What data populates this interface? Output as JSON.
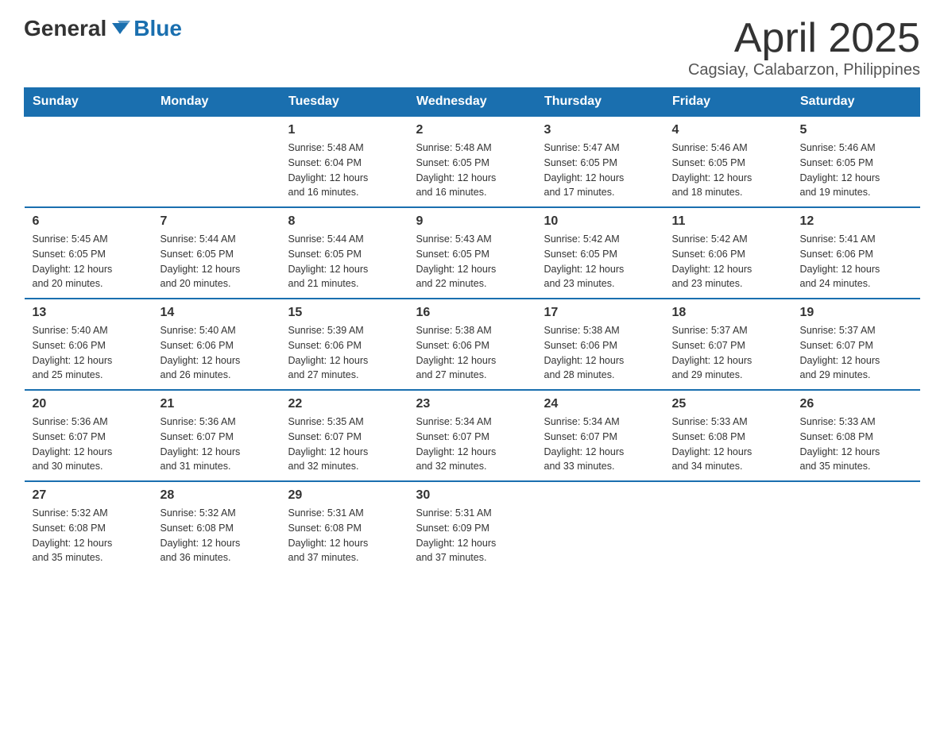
{
  "logo": {
    "text_general": "General",
    "text_blue": "Blue"
  },
  "header": {
    "title": "April 2025",
    "subtitle": "Cagsiay, Calabarzon, Philippines"
  },
  "weekdays": [
    "Sunday",
    "Monday",
    "Tuesday",
    "Wednesday",
    "Thursday",
    "Friday",
    "Saturday"
  ],
  "weeks": [
    [
      {
        "day": "",
        "info": ""
      },
      {
        "day": "",
        "info": ""
      },
      {
        "day": "1",
        "info": "Sunrise: 5:48 AM\nSunset: 6:04 PM\nDaylight: 12 hours\nand 16 minutes."
      },
      {
        "day": "2",
        "info": "Sunrise: 5:48 AM\nSunset: 6:05 PM\nDaylight: 12 hours\nand 16 minutes."
      },
      {
        "day": "3",
        "info": "Sunrise: 5:47 AM\nSunset: 6:05 PM\nDaylight: 12 hours\nand 17 minutes."
      },
      {
        "day": "4",
        "info": "Sunrise: 5:46 AM\nSunset: 6:05 PM\nDaylight: 12 hours\nand 18 minutes."
      },
      {
        "day": "5",
        "info": "Sunrise: 5:46 AM\nSunset: 6:05 PM\nDaylight: 12 hours\nand 19 minutes."
      }
    ],
    [
      {
        "day": "6",
        "info": "Sunrise: 5:45 AM\nSunset: 6:05 PM\nDaylight: 12 hours\nand 20 minutes."
      },
      {
        "day": "7",
        "info": "Sunrise: 5:44 AM\nSunset: 6:05 PM\nDaylight: 12 hours\nand 20 minutes."
      },
      {
        "day": "8",
        "info": "Sunrise: 5:44 AM\nSunset: 6:05 PM\nDaylight: 12 hours\nand 21 minutes."
      },
      {
        "day": "9",
        "info": "Sunrise: 5:43 AM\nSunset: 6:05 PM\nDaylight: 12 hours\nand 22 minutes."
      },
      {
        "day": "10",
        "info": "Sunrise: 5:42 AM\nSunset: 6:05 PM\nDaylight: 12 hours\nand 23 minutes."
      },
      {
        "day": "11",
        "info": "Sunrise: 5:42 AM\nSunset: 6:06 PM\nDaylight: 12 hours\nand 23 minutes."
      },
      {
        "day": "12",
        "info": "Sunrise: 5:41 AM\nSunset: 6:06 PM\nDaylight: 12 hours\nand 24 minutes."
      }
    ],
    [
      {
        "day": "13",
        "info": "Sunrise: 5:40 AM\nSunset: 6:06 PM\nDaylight: 12 hours\nand 25 minutes."
      },
      {
        "day": "14",
        "info": "Sunrise: 5:40 AM\nSunset: 6:06 PM\nDaylight: 12 hours\nand 26 minutes."
      },
      {
        "day": "15",
        "info": "Sunrise: 5:39 AM\nSunset: 6:06 PM\nDaylight: 12 hours\nand 27 minutes."
      },
      {
        "day": "16",
        "info": "Sunrise: 5:38 AM\nSunset: 6:06 PM\nDaylight: 12 hours\nand 27 minutes."
      },
      {
        "day": "17",
        "info": "Sunrise: 5:38 AM\nSunset: 6:06 PM\nDaylight: 12 hours\nand 28 minutes."
      },
      {
        "day": "18",
        "info": "Sunrise: 5:37 AM\nSunset: 6:07 PM\nDaylight: 12 hours\nand 29 minutes."
      },
      {
        "day": "19",
        "info": "Sunrise: 5:37 AM\nSunset: 6:07 PM\nDaylight: 12 hours\nand 29 minutes."
      }
    ],
    [
      {
        "day": "20",
        "info": "Sunrise: 5:36 AM\nSunset: 6:07 PM\nDaylight: 12 hours\nand 30 minutes."
      },
      {
        "day": "21",
        "info": "Sunrise: 5:36 AM\nSunset: 6:07 PM\nDaylight: 12 hours\nand 31 minutes."
      },
      {
        "day": "22",
        "info": "Sunrise: 5:35 AM\nSunset: 6:07 PM\nDaylight: 12 hours\nand 32 minutes."
      },
      {
        "day": "23",
        "info": "Sunrise: 5:34 AM\nSunset: 6:07 PM\nDaylight: 12 hours\nand 32 minutes."
      },
      {
        "day": "24",
        "info": "Sunrise: 5:34 AM\nSunset: 6:07 PM\nDaylight: 12 hours\nand 33 minutes."
      },
      {
        "day": "25",
        "info": "Sunrise: 5:33 AM\nSunset: 6:08 PM\nDaylight: 12 hours\nand 34 minutes."
      },
      {
        "day": "26",
        "info": "Sunrise: 5:33 AM\nSunset: 6:08 PM\nDaylight: 12 hours\nand 35 minutes."
      }
    ],
    [
      {
        "day": "27",
        "info": "Sunrise: 5:32 AM\nSunset: 6:08 PM\nDaylight: 12 hours\nand 35 minutes."
      },
      {
        "day": "28",
        "info": "Sunrise: 5:32 AM\nSunset: 6:08 PM\nDaylight: 12 hours\nand 36 minutes."
      },
      {
        "day": "29",
        "info": "Sunrise: 5:31 AM\nSunset: 6:08 PM\nDaylight: 12 hours\nand 37 minutes."
      },
      {
        "day": "30",
        "info": "Sunrise: 5:31 AM\nSunset: 6:09 PM\nDaylight: 12 hours\nand 37 minutes."
      },
      {
        "day": "",
        "info": ""
      },
      {
        "day": "",
        "info": ""
      },
      {
        "day": "",
        "info": ""
      }
    ]
  ]
}
